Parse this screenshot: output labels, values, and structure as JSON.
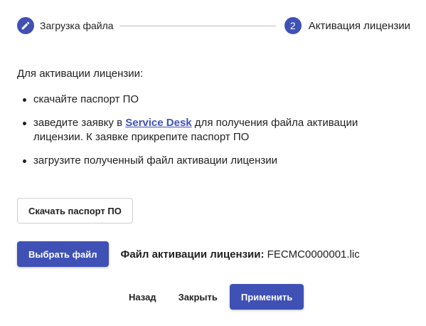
{
  "stepper": {
    "step1": {
      "label": "Загрузка файла",
      "icon": "edit-pencil-icon",
      "state": "completed"
    },
    "step2": {
      "number": "2",
      "label": "Активация лицензии",
      "state": "active"
    }
  },
  "content": {
    "intro": "Для активации лицензии:",
    "item1": "скачайте паспорт ПО",
    "item2_before": "заведите заявку в ",
    "item2_link": "Service Desk",
    "item2_after": " для получения файла активации лицензии. К заявке прикрепите паспорт ПО",
    "item3": "загрузите полученный файл активации лицензии"
  },
  "buttons": {
    "download_passport": "Скачать паспорт ПО",
    "choose_file": "Выбрать файл",
    "back": "Назад",
    "close": "Закрыть",
    "apply": "Применить"
  },
  "file": {
    "label": "Файл активации лицензии:",
    "name": "FECMC0000001.lic"
  },
  "colors": {
    "accent": "#3f51b5",
    "text": "#212121",
    "connector": "#bdbdbd"
  }
}
